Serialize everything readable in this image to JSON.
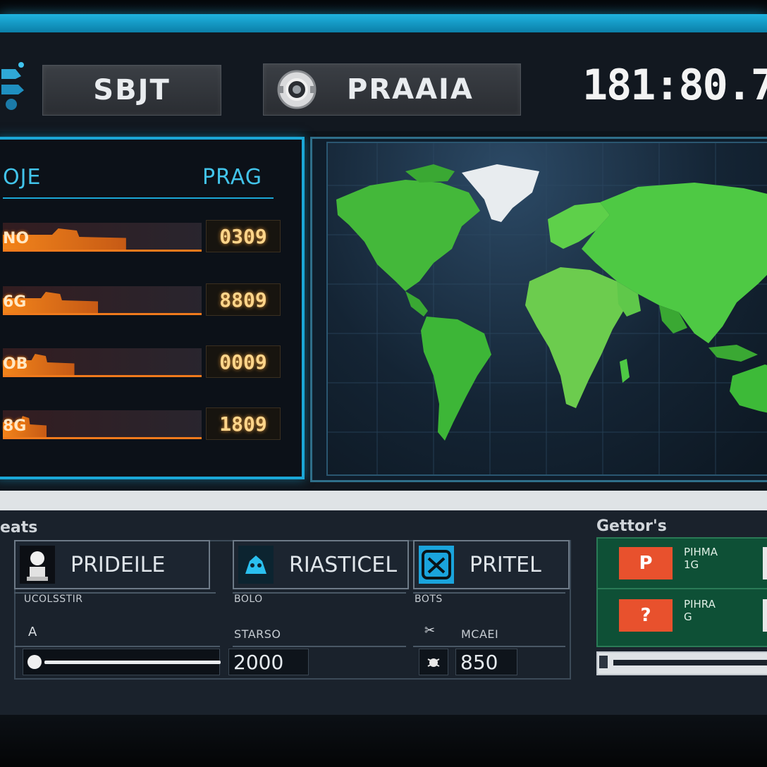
{
  "header": {
    "start_label": "SBJT",
    "prama_label": "PRAAIA",
    "clock": "181:80.7"
  },
  "leaderboard": {
    "col_left": "OJE",
    "col_right": "PRAG",
    "rows": [
      {
        "label": "NO",
        "score": "0309",
        "fill": 0.62
      },
      {
        "label": "6G",
        "score": "8809",
        "fill": 0.48
      },
      {
        "label": "OB",
        "score": "0009",
        "fill": 0.36
      },
      {
        "label": "8G",
        "score": "1809",
        "fill": 0.22
      }
    ]
  },
  "map": {
    "water_color": "#132638",
    "land_color": "#3fc03a",
    "ice_color": "#e8ecef"
  },
  "stats": {
    "title": "eats",
    "cards": [
      {
        "label": "PRIDEILE",
        "icon": "pawn-icon"
      },
      {
        "label": "RIASTICEL",
        "icon": "creature-icon"
      },
      {
        "label": "PRITEL",
        "icon": "shield-icon"
      }
    ],
    "sublabels": [
      "UCOLSSTIR",
      "BOLO",
      "BOTS"
    ],
    "field_left_label": "A",
    "field_mid_label": "STARSO",
    "field_mid_value": "2000",
    "field_right_label": "MCAEI",
    "field_right_value": "850",
    "slider_level": 0.9
  },
  "actions": {
    "title": "Gettor's",
    "items": [
      {
        "button": "P",
        "text_line1": "PIHMA",
        "text_line2": "1G"
      },
      {
        "button": "?",
        "text_line1": "PIHRA",
        "text_line2": "G"
      }
    ],
    "slider_level": 0.05
  }
}
